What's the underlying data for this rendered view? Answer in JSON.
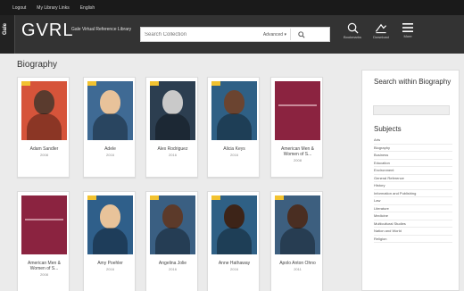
{
  "util_links": [
    "Logout",
    "My Library Links",
    "English"
  ],
  "header": {
    "gale": "Gale",
    "brand": "GVRL",
    "brand_sub": "Gale Virtual Reference Library",
    "search_placeholder": "Search Collection",
    "search_mode": "Advanced",
    "icons": [
      {
        "name": "bookmarks-icon",
        "label": "Bookmarks"
      },
      {
        "name": "download-icon",
        "label": "Download"
      },
      {
        "name": "menu-icon",
        "label": "More"
      }
    ]
  },
  "main": {
    "title": "Biography"
  },
  "books": [
    {
      "title": "Adam Sandler",
      "date": "2008",
      "cover_bg": "#d6543a",
      "accent": "#5a3b2e"
    },
    {
      "title": "Adele",
      "date": "2016",
      "cover_bg": "#3f6a94",
      "accent": "#e8c29a"
    },
    {
      "title": "Alex Rodriguez",
      "date": "2016",
      "cover_bg": "#2c3e50",
      "accent": "#c9c9c9"
    },
    {
      "title": "Alicia Keys",
      "date": "2016",
      "cover_bg": "#2f6085",
      "accent": "#6b4430"
    },
    {
      "title": "American Men & Women of S...",
      "date": "2008",
      "cover_bg": "#8b2340",
      "accent": "#6b1a30"
    },
    {
      "title": "American Men & Women of S...",
      "date": "2008",
      "cover_bg": "#8b2340",
      "accent": "#6b1a30"
    },
    {
      "title": "Amy Poehler",
      "date": "2016",
      "cover_bg": "#2f5f8a",
      "accent": "#e8c39a"
    },
    {
      "title": "Angelina Jolie",
      "date": "2016",
      "cover_bg": "#3a5f82",
      "accent": "#5c3a2a"
    },
    {
      "title": "Anne Hathaway",
      "date": "2016",
      "cover_bg": "#2f6085",
      "accent": "#3d2418"
    },
    {
      "title": "Apolo Anton Ohno",
      "date": "2011",
      "cover_bg": "#3d5f7f",
      "accent": "#4a2e22"
    }
  ],
  "sidebar": {
    "search_heading": "Search within Biography",
    "subjects_heading": "Subjects",
    "subjects": [
      "Arts",
      "Biography",
      "Business",
      "Education",
      "Environment",
      "General Reference",
      "History",
      "Information and Publishing",
      "Law",
      "Literature",
      "Medicine",
      "Multicultural Studies",
      "Nation and World",
      "Religion"
    ]
  },
  "colors": {
    "header": "#333333",
    "util_bar": "#1a1a1a",
    "background": "#ebebeb",
    "cover_banner": "#f2c230"
  }
}
